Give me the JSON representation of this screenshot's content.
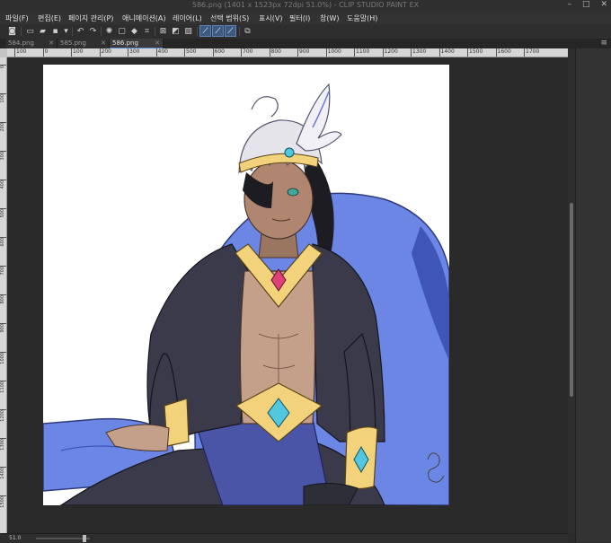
{
  "window": {
    "title": "586.png (1401 x 1523px 72dpi 51.0%) - CLIP STUDIO PAINT EX",
    "controls": [
      "–",
      "□",
      "✕"
    ]
  },
  "menu": [
    "파일(F)",
    "편집(E)",
    "페이지 관리(P)",
    "애니메이션(A)",
    "레이어(L)",
    "선택 범위(S)",
    "표시(V)",
    "필터(I)",
    "창(W)",
    "도움말(H)"
  ],
  "toolbar": {
    "icons": [
      "camera-icon",
      "new-file-icon",
      "open-icon",
      "save-icon",
      "undo-icon",
      "redo-icon",
      "loading-icon",
      "clear-icon",
      "fill-icon",
      "transform-icon",
      "deselect-icon",
      "invert-icon",
      "selection-border-icon",
      "snap-ruler-icon",
      "snap-special-ruler-icon",
      "snap-grid-icon",
      "settings-icon"
    ]
  },
  "tabs": [
    {
      "label": "584.png",
      "active": false
    },
    {
      "label": "585.png",
      "active": false
    },
    {
      "label": "586.png",
      "active": true
    }
  ],
  "panel_menu": "≡",
  "ruler": {
    "h_ticks": [
      "100",
      "0",
      "100",
      "200",
      "300",
      "400",
      "500",
      "600",
      "700",
      "800",
      "900",
      "1000",
      "1100",
      "1200",
      "1300",
      "1400",
      "1500",
      "1600",
      "1700"
    ],
    "v_ticks": [
      "0",
      "100",
      "200",
      "300",
      "400",
      "500",
      "600",
      "700",
      "800",
      "900",
      "1000",
      "1100",
      "1200",
      "1300",
      "1400",
      "1500"
    ]
  },
  "artwork": {
    "description_colors": {
      "throne": "#6b86e4",
      "skin": "#c4a08a",
      "robe": "#3a3a4a",
      "sash": "#4a55a8",
      "gold": "#f2d27a",
      "gem_cyan": "#52c8e0",
      "gem_pink": "#e0407a",
      "hair": "#e4e4ea",
      "ponytail": "#1c1c22"
    }
  },
  "status": {
    "zoom": "51.0",
    "info": ""
  }
}
